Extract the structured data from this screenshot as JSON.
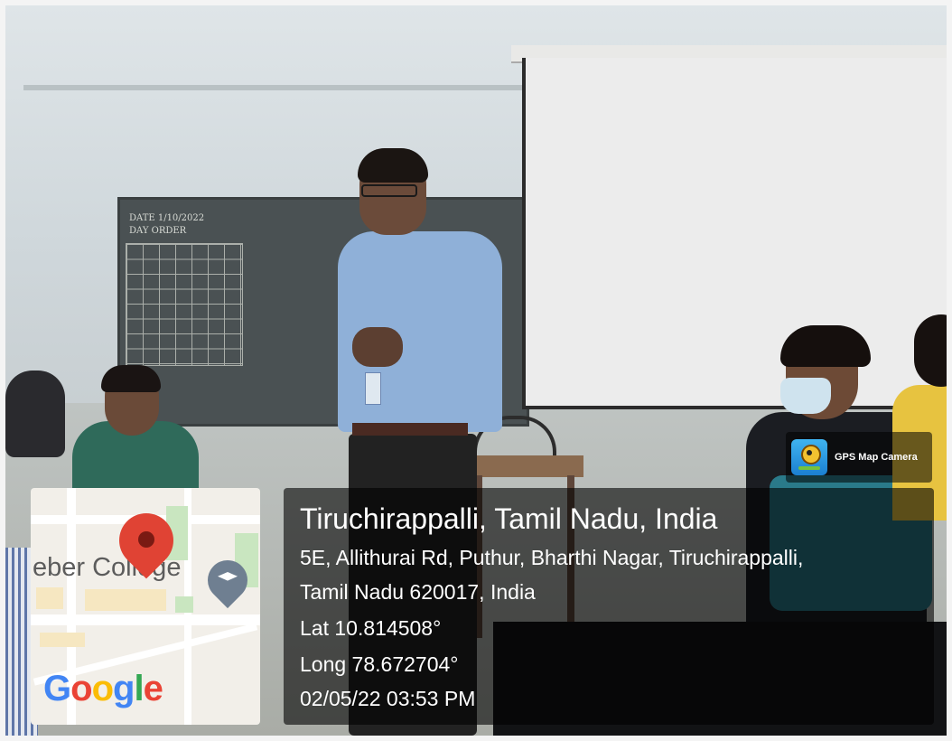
{
  "photo": {
    "scene": "classroom-lecture"
  },
  "chalkboard": {
    "line1": "DATE 1/10/2022",
    "line2": "DAY ORDER"
  },
  "map": {
    "place_label": "eber College",
    "logo": {
      "g1": "G",
      "o1": "o",
      "o2": "o",
      "g2": "g",
      "l": "l",
      "e": "e"
    },
    "icons": [
      "location-pin-icon",
      "graduation-cap-icon"
    ]
  },
  "gps_camera": {
    "label": "GPS Map Camera"
  },
  "location": {
    "title": "Tiruchirappalli, Tamil Nadu, India",
    "address_line1": "5E, Allithurai Rd, Puthur, Bharthi Nagar, Tiruchirappalli,",
    "address_line2": "Tamil Nadu 620017, India",
    "lat": "Lat 10.814508°",
    "long": "Long 78.672704°",
    "datetime": "02/05/22 03:53 PM"
  },
  "colors": {
    "pin": "#e04334",
    "google_blue": "#4285f4",
    "google_red": "#ea4335",
    "google_yellow": "#fbbc05",
    "google_green": "#34a853"
  }
}
